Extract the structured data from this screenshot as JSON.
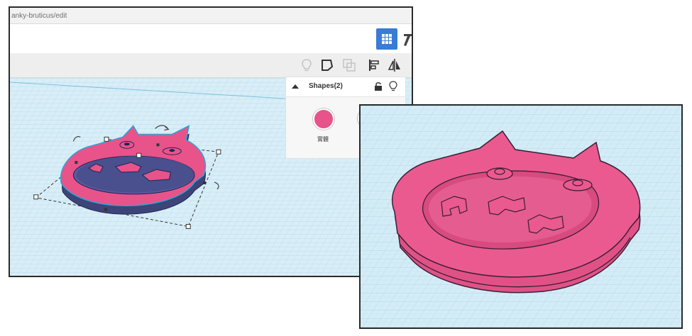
{
  "url": {
    "text": "anky-bruticus/edit"
  },
  "toolbar": {
    "grid_icon": "grid-view-icon",
    "hammer_icon": "hammer-icon",
    "tools": [
      {
        "name": "lightbulb-icon"
      },
      {
        "name": "shape-outline-icon"
      },
      {
        "name": "duplicate-icon"
      },
      {
        "name": "align-icon"
      },
      {
        "name": "mirror-icon"
      }
    ]
  },
  "shapes_panel": {
    "title": "Shapes(2)",
    "solid_label": "實體",
    "solid_color": "#e8538a"
  },
  "colors": {
    "workplane": "#d9eef7",
    "grid_line": "#8ec6df",
    "model_pink": "#e8538a",
    "model_dark": "#3d4478",
    "accent_blue": "#3a7bd5"
  }
}
